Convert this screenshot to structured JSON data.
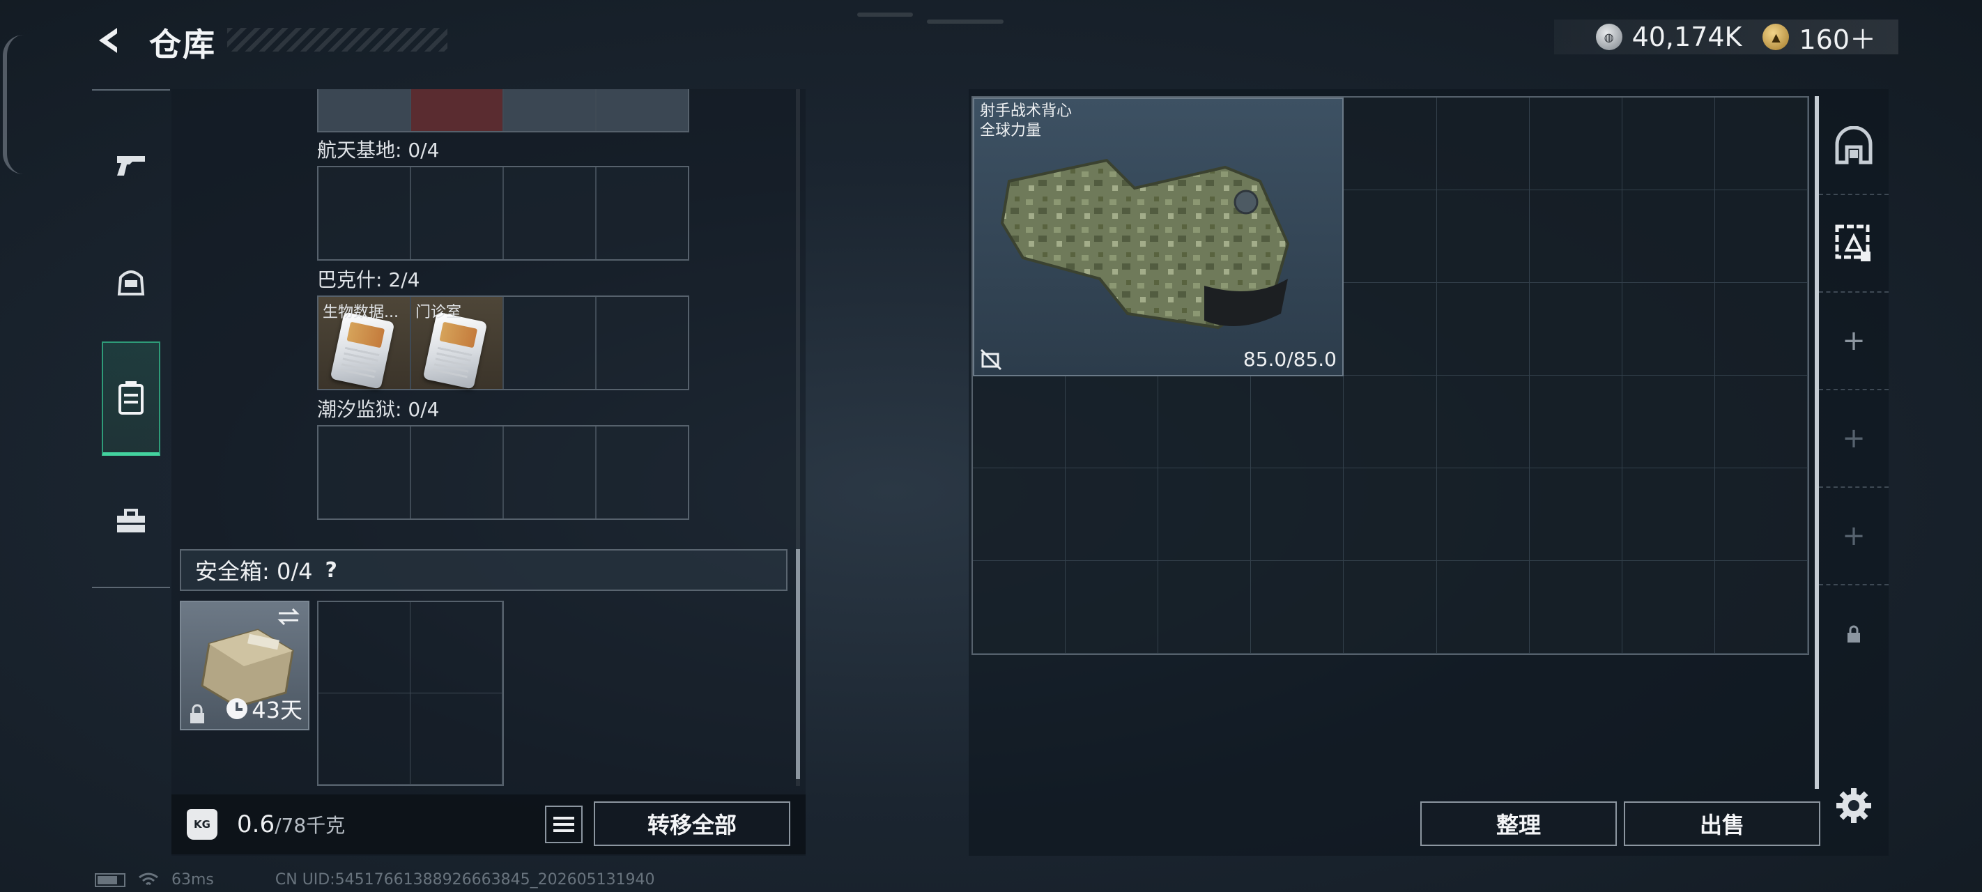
{
  "header": {
    "title": "仓库",
    "currencies": [
      {
        "icon": "silver-coin-icon",
        "value": "40,174K"
      },
      {
        "icon": "gold-coin-icon",
        "value": "160＋"
      }
    ]
  },
  "left_nav": {
    "items": [
      {
        "name": "weapon",
        "icon": "pistol-icon",
        "active": false
      },
      {
        "name": "armor",
        "icon": "helmet-icon",
        "active": false
      },
      {
        "name": "keycards",
        "icon": "keycard-holder-icon",
        "active": true
      },
      {
        "name": "tools",
        "icon": "toolbox-icon",
        "active": false
      }
    ]
  },
  "keycard_regions": [
    {
      "label": "航天基地: 0/4",
      "slots": []
    },
    {
      "label": "巴克什: 2/4",
      "slots": [
        "生物数据...",
        "门诊室"
      ]
    },
    {
      "label": "潮汐监狱: 0/4",
      "slots": []
    }
  ],
  "safe_box": {
    "label": "安全箱: 0/4",
    "help": "?",
    "timer": "43天"
  },
  "bottom_bar": {
    "weight_value": "0.6",
    "weight_max": "/78千克",
    "kg_label": "KG",
    "transfer_label": "转移全部"
  },
  "stash": {
    "item_name_line1": "射手战术背心",
    "item_name_line2": "全球力量",
    "durability": "85.0/85.0",
    "sort_label": "整理",
    "sell_label": "出售"
  },
  "status_bar": {
    "ping": "63ms",
    "uid": "CN UID:5451766138892666384​5_202605131940"
  },
  "colors": {
    "accent_green": "#43d39f",
    "panel_border": "#56616c"
  }
}
